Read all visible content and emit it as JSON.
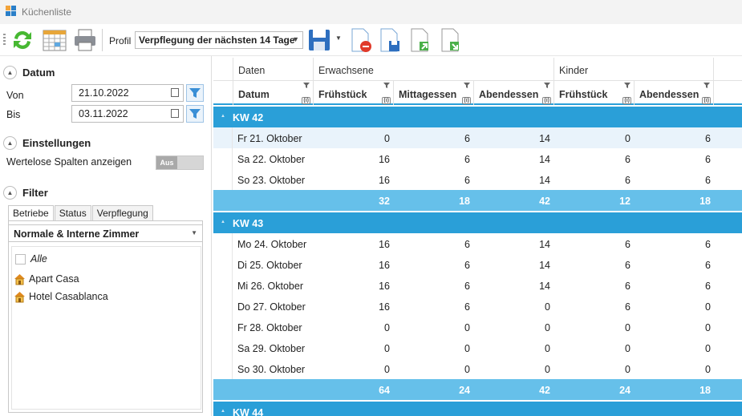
{
  "window": {
    "title": "Küchenliste"
  },
  "toolbar": {
    "profil_label": "Profil",
    "profil_value": "Verpflegung der nächsten 14 Tage",
    "buttons": [
      "refresh-icon",
      "calendar-icon",
      "print-icon",
      "save-icon",
      "delete-document-icon",
      "save-document-icon",
      "export-icon",
      "import-icon"
    ]
  },
  "sidebar": {
    "datum": {
      "title": "Datum",
      "von_label": "Von",
      "von_value": "21.10.2022",
      "bis_label": "Bis",
      "bis_value": "03.11.2022"
    },
    "einstellungen": {
      "title": "Einstellungen",
      "wertelose_label": "Wertelose Spalten anzeigen",
      "toggle_label": "Aus"
    },
    "filter": {
      "title": "Filter",
      "tabs": [
        "Betriebe",
        "Status",
        "Verpflegung"
      ],
      "zimmer_value": "Normale & Interne Zimmer",
      "items": [
        {
          "label": "Alle"
        },
        {
          "label": "Apart Casa"
        },
        {
          "label": "Hotel Casablanca"
        }
      ]
    }
  },
  "grid": {
    "band_headers": [
      "Daten",
      "Erwachsene",
      "Kinder"
    ],
    "columns": [
      "Datum",
      "Frühstück",
      "Mittagessen",
      "Abendessen",
      "Frühstück",
      "Abendessen"
    ],
    "info_glyph": "(i)",
    "groups": [
      {
        "label": "KW 42",
        "rows": [
          {
            "date": "Fr 21. Oktober",
            "values": [
              "0",
              "6",
              "14",
              "0",
              "6"
            ]
          },
          {
            "date": "Sa 22. Oktober",
            "values": [
              "16",
              "6",
              "14",
              "6",
              "6"
            ]
          },
          {
            "date": "So 23. Oktober",
            "values": [
              "16",
              "6",
              "14",
              "6",
              "6"
            ]
          }
        ],
        "totals": [
          "32",
          "18",
          "42",
          "12",
          "18"
        ]
      },
      {
        "label": "KW 43",
        "rows": [
          {
            "date": "Mo 24. Oktober",
            "values": [
              "16",
              "6",
              "14",
              "6",
              "6"
            ]
          },
          {
            "date": "Di 25. Oktober",
            "values": [
              "16",
              "6",
              "14",
              "6",
              "6"
            ]
          },
          {
            "date": "Mi 26. Oktober",
            "values": [
              "16",
              "6",
              "14",
              "6",
              "6"
            ]
          },
          {
            "date": "Do 27. Oktober",
            "values": [
              "16",
              "6",
              "0",
              "6",
              "0"
            ]
          },
          {
            "date": "Fr 28. Oktober",
            "values": [
              "0",
              "0",
              "0",
              "0",
              "0"
            ]
          },
          {
            "date": "Sa 29. Oktober",
            "values": [
              "0",
              "0",
              "0",
              "0",
              "0"
            ]
          },
          {
            "date": "So 30. Oktober",
            "values": [
              "0",
              "0",
              "0",
              "0",
              "0"
            ]
          }
        ],
        "totals": [
          "64",
          "24",
          "42",
          "24",
          "18"
        ]
      },
      {
        "label": "KW 44",
        "rows": [],
        "totals": []
      }
    ]
  },
  "colors": {
    "group_header": "#2a9fd8",
    "sum_row": "#66c0ea",
    "selected_row": "#e9f3fb"
  }
}
